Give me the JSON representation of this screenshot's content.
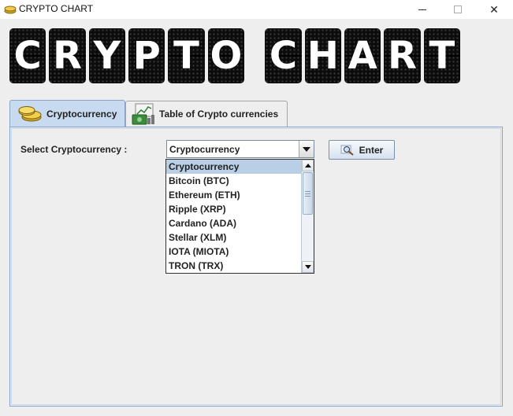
{
  "window": {
    "title": "CRYPTO CHART",
    "icons": {
      "app": "coins-icon",
      "minimize": "minimize-icon",
      "maximize": "maximize-icon",
      "close": "close-icon"
    },
    "close_glyph": "✕"
  },
  "banner": {
    "letters": [
      "C",
      "R",
      "Y",
      "P",
      "T",
      "O",
      " ",
      "C",
      "H",
      "A",
      "R",
      "T"
    ]
  },
  "tabs": [
    {
      "label": "Cryptocurrency",
      "icon": "coins-icon",
      "active": true
    },
    {
      "label": "Table of Crypto currencies",
      "icon": "money-chart-icon",
      "active": false
    }
  ],
  "form": {
    "select_label": "Select Cryptocurrency :",
    "combo_value": "Cryptocurrency",
    "enter_label": "Enter",
    "enter_icon": "search-magnifier-icon"
  },
  "dropdown": {
    "items": [
      "Cryptocurrency",
      "Bitcoin (BTC)",
      "Ethereum (ETH)",
      "Ripple (XRP)",
      "Cardano (ADA)",
      "Stellar (XLM)",
      "IOTA (MIOTA)",
      "TRON (TRX)"
    ],
    "selected_index": 0
  },
  "colors": {
    "accent": "#c8daf0",
    "selected_item": "#b8cfe5",
    "panel_border": "#8aa3c4"
  }
}
